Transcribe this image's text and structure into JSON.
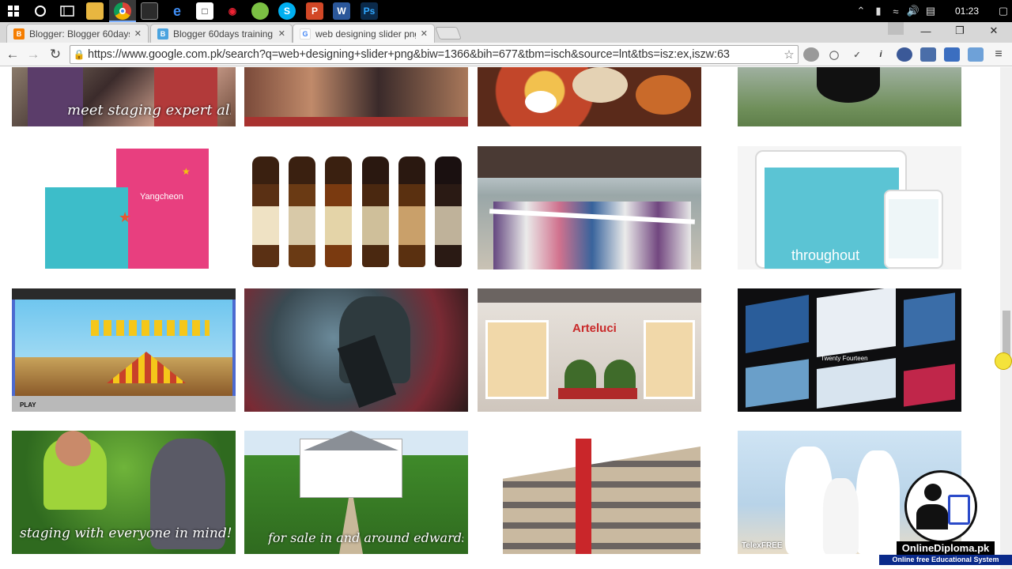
{
  "taskbar": {
    "apps": [
      {
        "name": "start",
        "icon": "windows-logo-icon"
      },
      {
        "name": "cortana",
        "icon": "search-circle-icon"
      },
      {
        "name": "task-view",
        "icon": "task-view-icon"
      },
      {
        "name": "file-explorer",
        "icon": "folder-icon"
      },
      {
        "name": "chrome",
        "icon": "chrome-icon"
      },
      {
        "name": "store",
        "icon": "store-icon"
      },
      {
        "name": "edge",
        "icon": "edge-icon"
      },
      {
        "name": "app-white",
        "icon": "app-icon"
      },
      {
        "name": "app-red",
        "icon": "app-icon"
      },
      {
        "name": "app-green",
        "icon": "app-icon"
      },
      {
        "name": "skype",
        "icon": "skype-icon"
      },
      {
        "name": "powerpoint",
        "icon": "powerpoint-icon"
      },
      {
        "name": "word",
        "icon": "word-icon"
      },
      {
        "name": "photoshop",
        "icon": "photoshop-icon"
      }
    ],
    "clock": "01:23"
  },
  "browser": {
    "tabs": [
      {
        "title": "Blogger: Blogger 60days t",
        "favicon": "blogger-icon"
      },
      {
        "title": "Blogger 60days training",
        "favicon": "blogger-icon"
      },
      {
        "title": "web designing slider png",
        "favicon": "google-icon",
        "active": true
      }
    ],
    "url": "https://www.google.com.pk/search?q=web+designing+slider+png&biw=1366&bih=677&tbm=isch&source=lnt&tbs=isz:ex,iszw:63"
  },
  "results": [
    {
      "caption": "meet staging expert allison hansen",
      "subject": "people"
    },
    {
      "caption": "",
      "subject": "tattoo"
    },
    {
      "caption": "",
      "subject": "food"
    },
    {
      "caption": "",
      "subject": "golf"
    },
    {
      "caption": "",
      "subject": "book",
      "inner_text": "Yangcheon"
    },
    {
      "caption": "",
      "subject": "beer-bottles"
    },
    {
      "caption": "",
      "subject": "ribbon-cutting"
    },
    {
      "caption": "throughout",
      "subject": "tablet-phone"
    },
    {
      "caption": "",
      "subject": "mario-maker",
      "inner_text": "PLAY"
    },
    {
      "caption": "",
      "subject": "soldier"
    },
    {
      "caption": "",
      "subject": "storefront",
      "inner_text": "Arteluci"
    },
    {
      "caption": "",
      "subject": "wordpress-themes",
      "inner_text": "Twenty Fourteen"
    },
    {
      "caption": "staging with everyone in mind!",
      "subject": "baby-dog"
    },
    {
      "caption": "for sale in and around edwardsville",
      "subject": "house"
    },
    {
      "caption": "",
      "subject": "building"
    },
    {
      "caption": "",
      "subject": "family",
      "inner_text": "TelexFREE"
    }
  ],
  "watermark": {
    "site": "OnlineDiploma.pk",
    "tagline": "Online free Educational System"
  }
}
